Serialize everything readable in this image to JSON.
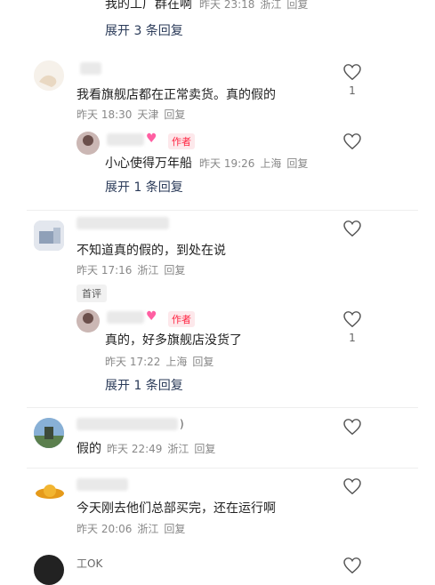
{
  "top_reply": {
    "text": "我的工厂群在啊",
    "time": "昨天 23:18",
    "place": "浙江",
    "reply": "回复"
  },
  "top_expand": "展开 3 条回复",
  "comments": [
    {
      "text": "我看旗舰店都在正常卖货。真的假的",
      "time": "昨天 18:30",
      "place": "天津",
      "reply": "回复",
      "likes": "1"
    },
    {
      "text": "不知道真的假的，到处在说",
      "time": "昨天 17:16",
      "place": "浙江",
      "reply": "回复",
      "badge": "首评"
    },
    {
      "text": "假的",
      "time": "昨天 22:49",
      "place": "浙江",
      "reply": "回复",
      "name_tail": ")"
    },
    {
      "text": "今天刚去他们总部买完，还在运行啊",
      "time": "昨天 20:06",
      "place": "浙江",
      "reply": "回复"
    },
    {
      "name_partial": "工OK"
    }
  ],
  "replies": [
    {
      "author_tag": "作者",
      "text": "小心使得万年船",
      "time": "昨天 19:26",
      "place": "上海",
      "reply": "回复",
      "expand": "展开 1 条回复"
    },
    {
      "author_tag": "作者",
      "text": "真的，好多旗舰店没货了",
      "time": "昨天 17:22",
      "place": "上海",
      "reply": "回复",
      "likes": "1",
      "expand": "展开 1 条回复"
    }
  ],
  "colors": {
    "like_icon": "#555555",
    "author_tag": "#ff2442",
    "expand_text": "#2b3b59",
    "heart_emoji": "#ff5fa2"
  },
  "icons": {
    "like": "heart-outline-icon",
    "emoji": "pink-heart-icon"
  }
}
